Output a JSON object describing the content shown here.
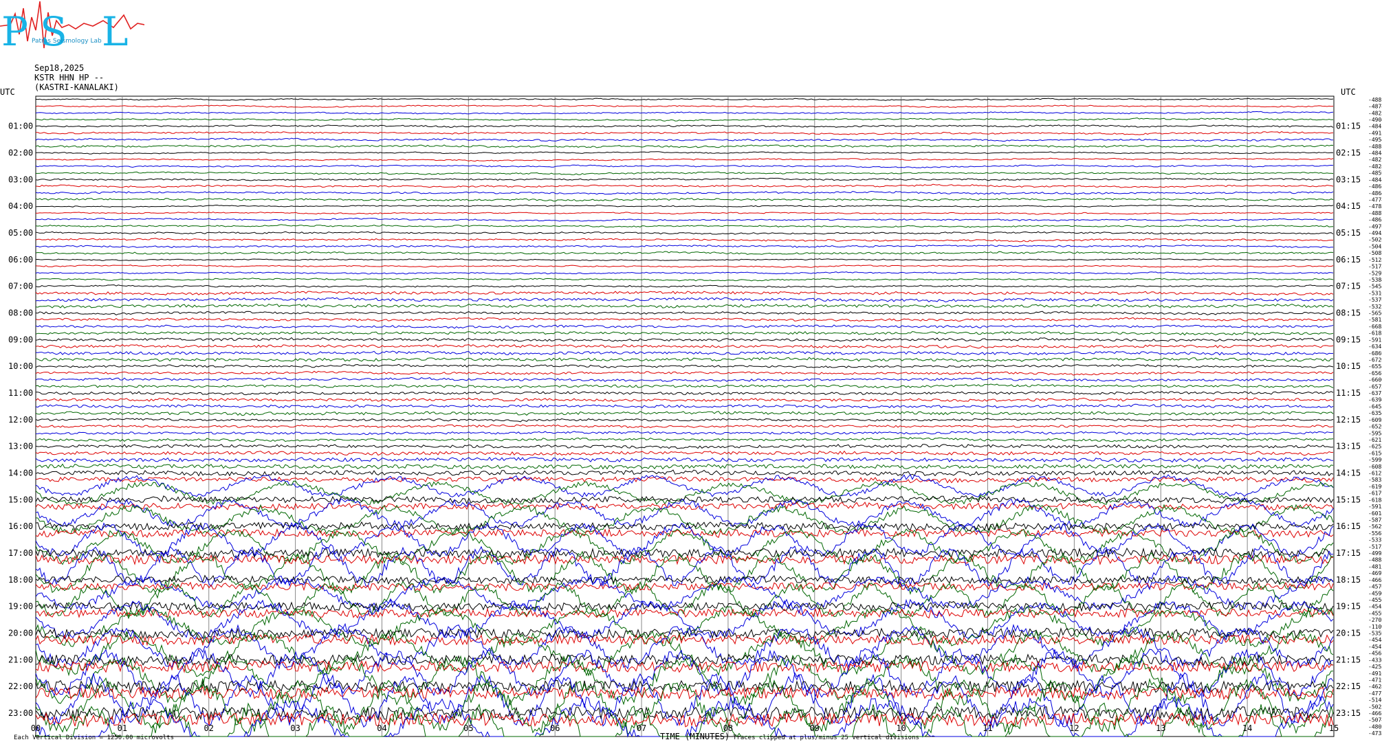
{
  "logo": {
    "text_p": "P",
    "text_s": "S",
    "text_l": "L",
    "caption": "Patras Seismology Lab"
  },
  "header": {
    "date": "Sep18,2025",
    "station": "KSTR HHN HP --",
    "location": "(KASTRI-KANALAKI)"
  },
  "colors": {
    "trace_cycle": [
      "#000000",
      "#dd0000",
      "#0000dd",
      "#006600"
    ],
    "grid": "#888888"
  },
  "chart_data": {
    "type": "line",
    "title": "",
    "left_axis_label": "UTC",
    "right_axis_label": "UTC",
    "left_hour_labels": [
      "01:00",
      "02:00",
      "03:00",
      "04:00",
      "05:00",
      "06:00",
      "07:00",
      "08:00",
      "09:00",
      "10:00",
      "11:00",
      "12:00",
      "13:00",
      "14:00",
      "15:00",
      "16:00",
      "17:00",
      "18:00",
      "19:00",
      "20:00",
      "21:00",
      "22:00",
      "23:00"
    ],
    "right_hour_labels": [
      "01:15",
      "02:15",
      "03:15",
      "04:15",
      "05:15",
      "06:15",
      "07:15",
      "08:15",
      "09:15",
      "10:15",
      "11:15",
      "12:15",
      "13:15",
      "14:15",
      "15:15",
      "16:15",
      "17:15",
      "18:15",
      "19:15",
      "20:15",
      "21:15",
      "22:15",
      "23:15"
    ],
    "x_ticks": [
      "00",
      "01",
      "02",
      "03",
      "04",
      "05",
      "06",
      "07",
      "08",
      "09",
      "10",
      "11",
      "12",
      "13",
      "14",
      "15"
    ],
    "xlabel": "TIME (MINUTES)",
    "xlim": [
      0,
      15
    ],
    "trace_count": 96,
    "trace_values": [
      "-4881",
      "-4874",
      "-4823",
      "-4904",
      "-4841",
      "-4918",
      "-4954",
      "-4881",
      "-4844",
      "-4827",
      "-4824",
      "-4859",
      "-4844",
      "-4862",
      "-4864",
      "-4774",
      "-4785",
      "-4887",
      "-4865",
      "-4976",
      "-4945",
      "-5026",
      "-5042",
      "-5087",
      "-5128",
      "-5173",
      "-5297",
      "-5384",
      "-5458",
      "-5310",
      "-5376",
      "-5322",
      "-5656",
      "-5812",
      "-6683",
      "-6185",
      "-5911",
      "-6341",
      "-6869",
      "-6720",
      "-6558",
      "-6567",
      "-6600",
      "-6573",
      "-6371",
      "-6394",
      "-6455",
      "-6354",
      "-6095",
      "-6526",
      "-5958",
      "-6217",
      "-6252",
      "-6156",
      "-5999",
      "-6087",
      "-6127",
      "-5832",
      "-6199",
      "-6179",
      "-6188",
      "-5913",
      "-6014",
      "-5872",
      "-5629",
      "-5567",
      "-5337",
      "-5172",
      "-4993",
      "-4885",
      "-4812",
      "-4697",
      "-4662",
      "-4570",
      "-4590",
      "-4556",
      "-4545",
      "-4559",
      "-2702",
      "-1109",
      "-5359",
      "-4544",
      "-4547",
      "-4561",
      "-4336",
      "-4255",
      "-4916",
      "-4719",
      "-4624",
      "-4777",
      "-5146",
      "-5025",
      "-4662",
      "-5074",
      "-4802",
      "-4733"
    ],
    "grid": true,
    "vertical_division_note": "Each Vertical Division = 1250.00 microvolts",
    "clip_note": "Traces clipped at plus/minus 25 vertical divisions"
  }
}
